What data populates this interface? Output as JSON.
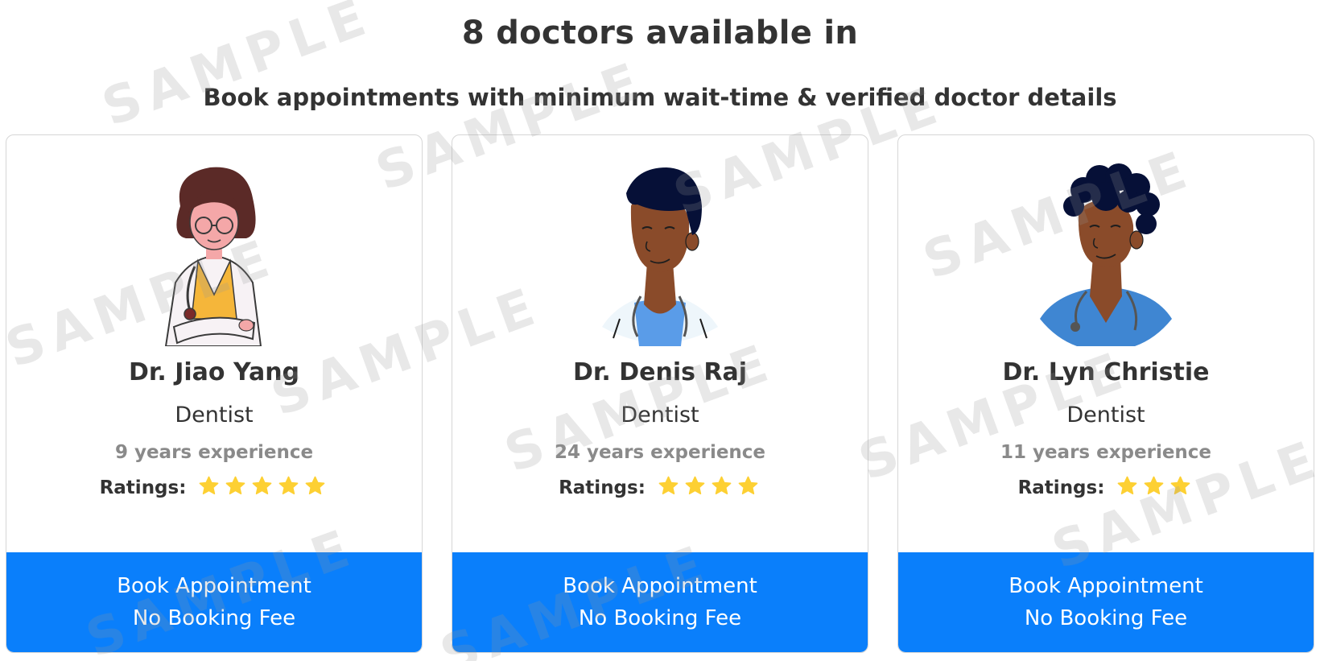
{
  "header": {
    "title": "8 doctors available in",
    "subtitle": "Book appointments with minimum wait-time & verified doctor details"
  },
  "watermark": "SAMPLE",
  "colors": {
    "button_bg": "#0a7ffb",
    "star": "#fdd033",
    "experience_text": "#8a8a8a"
  },
  "doctors": [
    {
      "name": "Dr. Jiao Yang",
      "specialty": "Dentist",
      "experience": "9 years experience",
      "ratings_label": "Ratings:",
      "rating": 5,
      "avatar": "female-doctor-avatar",
      "button_line1": "Book Appointment",
      "button_line2": "No Booking Fee"
    },
    {
      "name": "Dr. Denis Raj",
      "specialty": "Dentist",
      "experience": "24 years experience",
      "ratings_label": "Ratings:",
      "rating": 4,
      "avatar": "male-doctor-avatar",
      "button_line1": "Book Appointment",
      "button_line2": "No Booking Fee"
    },
    {
      "name": "Dr. Lyn Christie",
      "specialty": "Dentist",
      "experience": "11 years experience",
      "ratings_label": "Ratings:",
      "rating": 3,
      "avatar": "curly-hair-doctor-avatar",
      "button_line1": "Book Appointment",
      "button_line2": "No Booking Fee"
    }
  ]
}
